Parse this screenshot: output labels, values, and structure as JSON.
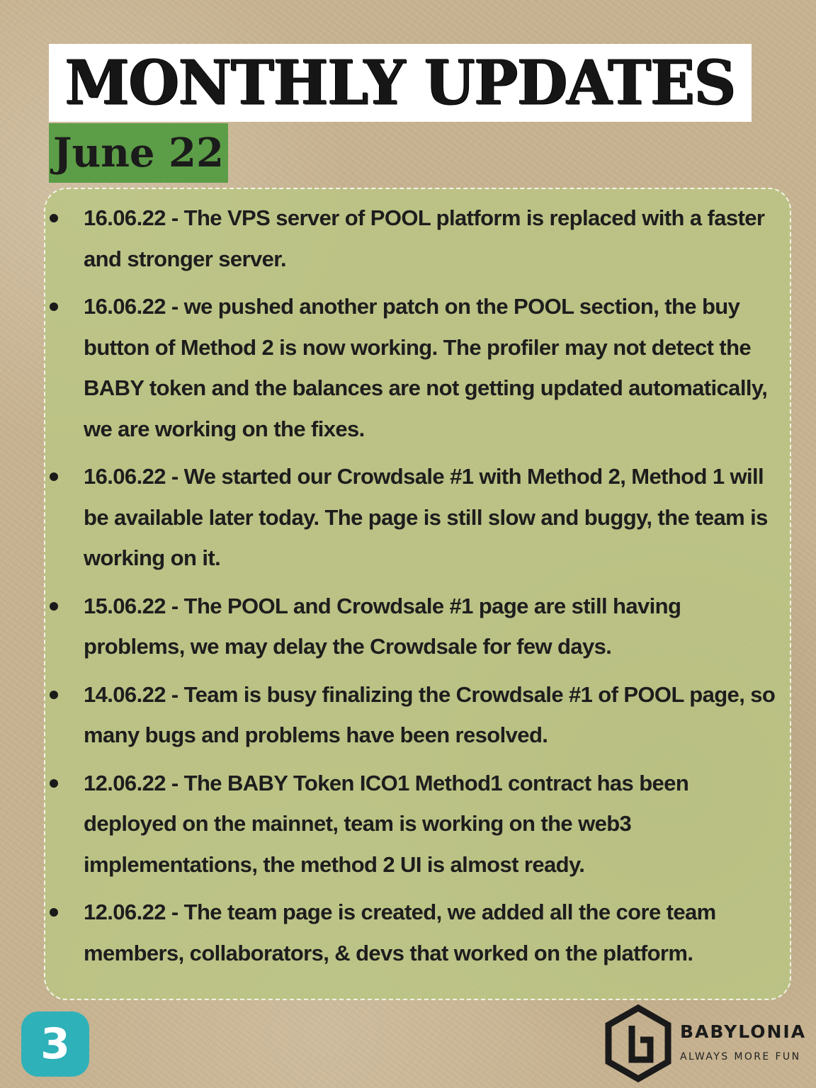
{
  "header": {
    "title": "MONTHLY UPDATES",
    "date": "June 22"
  },
  "updates": [
    {
      "text": "16.06.22 - The VPS server of POOL platform is replaced with a faster and stronger server."
    },
    {
      "text": "16.06.22 - we pushed another patch on the POOL section, the buy button of Method 2 is now working. The profiler may not detect the BABY token and the balances are not getting updated automatically, we are working on the fixes."
    },
    {
      "text": "16.06.22 - We started our Crowdsale #1 with Method 2, Method 1 will be available later today. The page is still slow and buggy, the team is working on it."
    },
    {
      "text": "15.06.22 - The POOL and Crowdsale #1 page are still having problems, we may delay the Crowdsale for few days."
    },
    {
      "text": "14.06.22 - Team is busy finalizing the Crowdsale #1 of POOL page, so many bugs and problems have been resolved."
    },
    {
      "text": "12.06.22 - The BABY Token ICO1 Method1 contract has been deployed on the mainnet, team is working on the web3 implementations, the method 2 UI is almost ready."
    },
    {
      "text": "12.06.22 - The team page is created, we added all the core team members, collaborators, & devs that worked on the platform."
    }
  ],
  "footer": {
    "page_number": "3",
    "brand_name": "BABYLONIA",
    "brand_tagline": "ALWAYS MORE FUN",
    "logo_icon": "babylonia-hexagon-logo-icon"
  },
  "colors": {
    "background": "#c7b391",
    "title_bg": "#ffffff",
    "date_bg": "#5c9d47",
    "panel_bg": "#bac682",
    "badge_bg": "#2fb1b9"
  }
}
